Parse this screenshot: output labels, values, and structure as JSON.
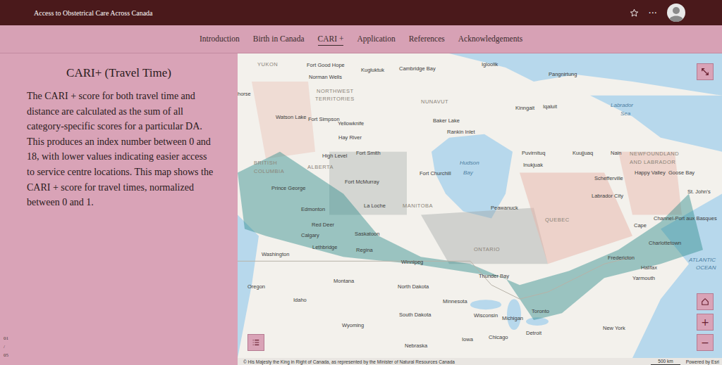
{
  "header": {
    "title": "Access to Obstetrical Care Across Canada",
    "menu": "···"
  },
  "tabs": [
    {
      "label": "Introduction",
      "selected": false
    },
    {
      "label": "Birth in Canada",
      "selected": false
    },
    {
      "label": "CARI +",
      "selected": true
    },
    {
      "label": "Application",
      "selected": false
    },
    {
      "label": "References",
      "selected": false
    },
    {
      "label": "Acknowledgements",
      "selected": false
    }
  ],
  "panel": {
    "heading": "CARI+ (Travel Time)",
    "body": "The CARI + score for both travel time and distance are calculated as the sum of all category-specific scores for a particular DA. This produces an index number between 0 and 18, with lower values indicating easier access to service centre locations. This map shows the CARI + score for travel times, normalized between 0 and 1."
  },
  "pager": {
    "current": "01",
    "separator": "/",
    "total": "05"
  },
  "map": {
    "labels": [
      {
        "text": "YUKON",
        "kind": "region"
      },
      {
        "text": "Fort Good Hope",
        "kind": "place"
      },
      {
        "text": "Norman Wells",
        "kind": "place"
      },
      {
        "text": "Kugluktuk",
        "kind": "place"
      },
      {
        "text": "Cambridge Bay",
        "kind": "place"
      },
      {
        "text": "Igloolik",
        "kind": "place"
      },
      {
        "text": "Pangnirtung",
        "kind": "place"
      },
      {
        "text": "NORTHWEST",
        "kind": "region"
      },
      {
        "text": "TERRITORIES",
        "kind": "region"
      },
      {
        "text": "NUNAVUT",
        "kind": "region"
      },
      {
        "text": "Iqaluit",
        "kind": "place"
      },
      {
        "text": "Kinngait",
        "kind": "place"
      },
      {
        "text": "Labrador",
        "kind": "water"
      },
      {
        "text": "Sea",
        "kind": "water"
      },
      {
        "text": "horse",
        "kind": "place"
      },
      {
        "text": "Watson Lake",
        "kind": "place"
      },
      {
        "text": "Fort Simpson",
        "kind": "place"
      },
      {
        "text": "Yellowknife",
        "kind": "place"
      },
      {
        "text": "Baker Lake",
        "kind": "place"
      },
      {
        "text": "Rankin Inlet",
        "kind": "place"
      },
      {
        "text": "Hay River",
        "kind": "place"
      },
      {
        "text": "Fort Smith",
        "kind": "place"
      },
      {
        "text": "High Level",
        "kind": "place"
      },
      {
        "text": "Fort Churchill",
        "kind": "place"
      },
      {
        "text": "Hudson",
        "kind": "water"
      },
      {
        "text": "Bay",
        "kind": "water"
      },
      {
        "text": "Puvirnituq",
        "kind": "place"
      },
      {
        "text": "Kuujjuaq",
        "kind": "place"
      },
      {
        "text": "Nain",
        "kind": "place"
      },
      {
        "text": "NEWFOUNDLAND",
        "kind": "region"
      },
      {
        "text": "AND LABRADOR",
        "kind": "region"
      },
      {
        "text": "Inukjuak",
        "kind": "place"
      },
      {
        "text": "Happy Valley",
        "kind": "place"
      },
      {
        "text": "Goose Bay",
        "kind": "place"
      },
      {
        "text": "BRITISH",
        "kind": "region"
      },
      {
        "text": "COLUMBIA",
        "kind": "region"
      },
      {
        "text": "ALBERTA",
        "kind": "region"
      },
      {
        "text": "Fort McMurray",
        "kind": "place"
      },
      {
        "text": "Prince George",
        "kind": "place"
      },
      {
        "text": "MANITOBA",
        "kind": "region"
      },
      {
        "text": "Schefferville",
        "kind": "place"
      },
      {
        "text": "Labrador City",
        "kind": "place"
      },
      {
        "text": "La Loche",
        "kind": "place"
      },
      {
        "text": "St. John's",
        "kind": "place"
      },
      {
        "text": "Edmonton",
        "kind": "place"
      },
      {
        "text": "Peawanuck",
        "kind": "place"
      },
      {
        "text": "QUEBEC",
        "kind": "region"
      },
      {
        "text": "Channel-Port aux Basques",
        "kind": "place"
      },
      {
        "text": "Red Deer",
        "kind": "place"
      },
      {
        "text": "Saskatoon",
        "kind": "place"
      },
      {
        "text": "Calgary",
        "kind": "place"
      },
      {
        "text": "Cape",
        "kind": "place"
      },
      {
        "text": "Charlottetown",
        "kind": "place"
      },
      {
        "text": "Lethbridge",
        "kind": "place"
      },
      {
        "text": "Regina",
        "kind": "place"
      },
      {
        "text": "Winnipeg",
        "kind": "place"
      },
      {
        "text": "ONTARIO",
        "kind": "region"
      },
      {
        "text": "Washington",
        "kind": "place"
      },
      {
        "text": "Fredericton",
        "kind": "place"
      },
      {
        "text": "Halifax",
        "kind": "place"
      },
      {
        "text": "Yarmouth",
        "kind": "place"
      },
      {
        "text": "ATLANTIC",
        "kind": "water"
      },
      {
        "text": "OCEAN",
        "kind": "water"
      },
      {
        "text": "Montana",
        "kind": "place"
      },
      {
        "text": "North Dakota",
        "kind": "place"
      },
      {
        "text": "Thunder Bay",
        "kind": "place"
      },
      {
        "text": "Oregon",
        "kind": "place"
      },
      {
        "text": "Idaho",
        "kind": "place"
      },
      {
        "text": "Minnesota",
        "kind": "place"
      },
      {
        "text": "Toronto",
        "kind": "place"
      },
      {
        "text": "South Dakota",
        "kind": "place"
      },
      {
        "text": "Wisconsin",
        "kind": "place"
      },
      {
        "text": "Michigan",
        "kind": "place"
      },
      {
        "text": "Wyoming",
        "kind": "place"
      },
      {
        "text": "Detroit",
        "kind": "place"
      },
      {
        "text": "New York",
        "kind": "place"
      },
      {
        "text": "Chicago",
        "kind": "place"
      },
      {
        "text": "Iowa",
        "kind": "place"
      },
      {
        "text": "Nebraska",
        "kind": "place"
      }
    ],
    "scale": "500 km",
    "attribution": "© His Majesty the King in Right of Canada, as represented by the Minister of Natural Resources Canada",
    "powered_by": "Powered by Esri",
    "zoom_in": "+",
    "zoom_out": "−"
  }
}
